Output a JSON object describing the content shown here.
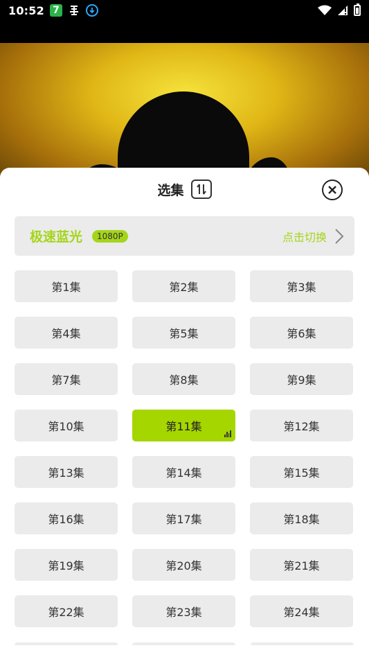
{
  "status_bar": {
    "time": "10:52",
    "app_badge": "7",
    "bug_icon": "bug-icon",
    "download_icon": "download-icon",
    "wifi_icon": "wifi-icon",
    "signal_icon": "signal-icon",
    "battery_icon": "battery-icon"
  },
  "sheet": {
    "title": "选集",
    "sort_icon": "sort-icon",
    "close_icon": "close-icon"
  },
  "quality": {
    "name": "极速蓝光",
    "badge": "1080P",
    "switch_label": "点击切换",
    "accent_color": "#a5d51a"
  },
  "episodes": [
    {
      "label": "第1集"
    },
    {
      "label": "第2集"
    },
    {
      "label": "第3集"
    },
    {
      "label": "第4集"
    },
    {
      "label": "第5集"
    },
    {
      "label": "第6集"
    },
    {
      "label": "第7集"
    },
    {
      "label": "第8集"
    },
    {
      "label": "第9集"
    },
    {
      "label": "第10集"
    },
    {
      "label": "第11集",
      "active": true
    },
    {
      "label": "第12集"
    },
    {
      "label": "第13集"
    },
    {
      "label": "第14集"
    },
    {
      "label": "第15集"
    },
    {
      "label": "第16集"
    },
    {
      "label": "第17集"
    },
    {
      "label": "第18集"
    },
    {
      "label": "第19集"
    },
    {
      "label": "第20集"
    },
    {
      "label": "第21集"
    },
    {
      "label": "第22集"
    },
    {
      "label": "第23集"
    },
    {
      "label": "第24集"
    }
  ]
}
